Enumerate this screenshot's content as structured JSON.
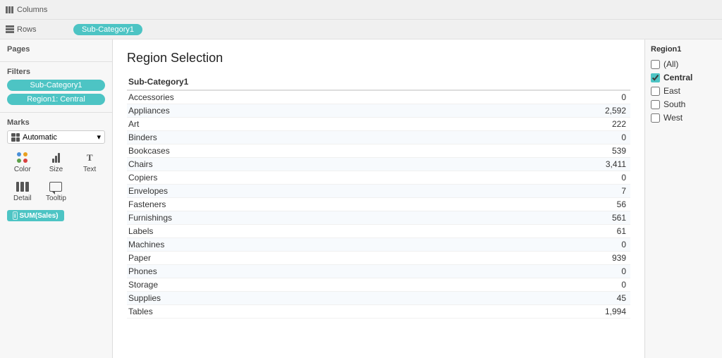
{
  "toolbar": {
    "columns_label": "Columns",
    "rows_label": "Rows",
    "columns_icon": "grid-icon",
    "rows_icon": "rows-icon",
    "rows_pill": "Sub-Category1"
  },
  "sidebar": {
    "pages_title": "Pages",
    "filters_title": "Filters",
    "filter1": "Sub-Category1",
    "filter2": "Region1: Central",
    "marks_title": "Marks",
    "marks_dropdown": "Automatic",
    "marks_items": [
      {
        "name": "Color",
        "key": "color"
      },
      {
        "name": "Size",
        "key": "size"
      },
      {
        "name": "Text",
        "key": "text"
      },
      {
        "name": "Detail",
        "key": "detail"
      },
      {
        "name": "Tooltip",
        "key": "tooltip"
      }
    ],
    "sum_label": "SUM(Sales)"
  },
  "content": {
    "title": "Region Selection",
    "table_header_col1": "Sub-Category1",
    "table_header_col2": "",
    "rows": [
      {
        "label": "Accessories",
        "value": "0"
      },
      {
        "label": "Appliances",
        "value": "2,592"
      },
      {
        "label": "Art",
        "value": "222"
      },
      {
        "label": "Binders",
        "value": "0"
      },
      {
        "label": "Bookcases",
        "value": "539"
      },
      {
        "label": "Chairs",
        "value": "3,411"
      },
      {
        "label": "Copiers",
        "value": "0"
      },
      {
        "label": "Envelopes",
        "value": "7"
      },
      {
        "label": "Fasteners",
        "value": "56"
      },
      {
        "label": "Furnishings",
        "value": "561"
      },
      {
        "label": "Labels",
        "value": "61"
      },
      {
        "label": "Machines",
        "value": "0"
      },
      {
        "label": "Paper",
        "value": "939"
      },
      {
        "label": "Phones",
        "value": "0"
      },
      {
        "label": "Storage",
        "value": "0"
      },
      {
        "label": "Supplies",
        "value": "45"
      },
      {
        "label": "Tables",
        "value": "1,994"
      }
    ]
  },
  "right_panel": {
    "title": "Region1",
    "options": [
      {
        "label": "(All)",
        "checked": false
      },
      {
        "label": "Central",
        "checked": true
      },
      {
        "label": "East",
        "checked": false
      },
      {
        "label": "South",
        "checked": false
      },
      {
        "label": "West",
        "checked": false
      }
    ]
  }
}
